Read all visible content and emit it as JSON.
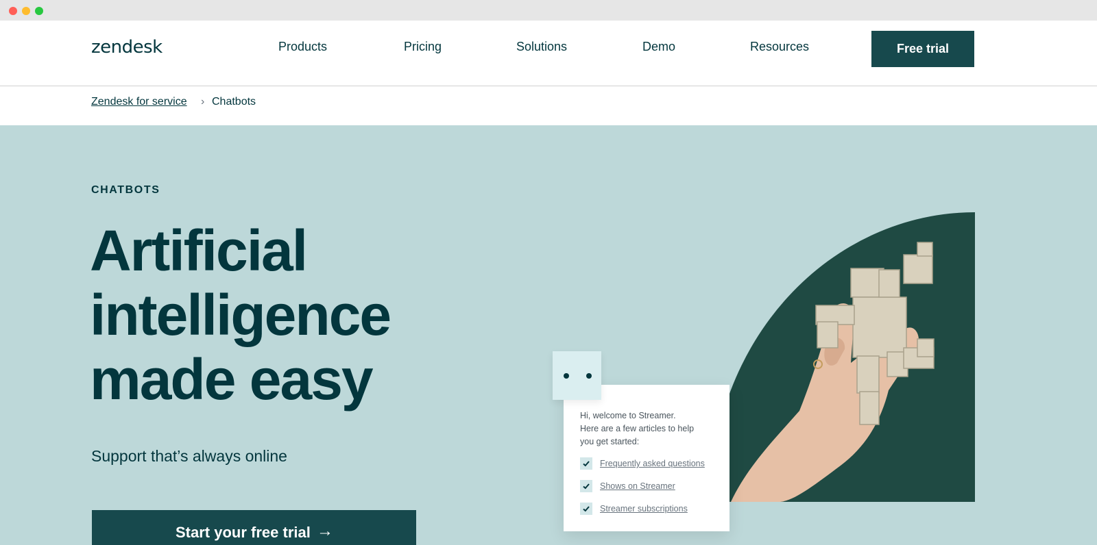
{
  "browser": {
    "window_controls": [
      "close",
      "minimize",
      "maximize"
    ]
  },
  "header": {
    "logo": "zendesk",
    "nav": [
      "Products",
      "Pricing",
      "Solutions",
      "Demo",
      "Resources"
    ],
    "cta_label": "Free trial"
  },
  "breadcrumb": {
    "parent": "Zendesk for service",
    "separator": "›",
    "current": "Chatbots"
  },
  "hero": {
    "eyebrow": "CHATBOTS",
    "headline": [
      "Artificial",
      "intelligence",
      "made easy"
    ],
    "subhead": "Support that’s always online",
    "cta_label": "Start your free trial",
    "cta_icon": "arrow-right-icon"
  },
  "chat_widget": {
    "greeting": [
      "Hi, welcome to Streamer.",
      "Here are a few articles to help",
      "you get started:"
    ],
    "links": [
      "Frequently asked questions",
      "Shows on Streamer",
      "Streamer subscriptions"
    ]
  },
  "colors": {
    "brand_dark": "#03363d",
    "button": "#17494d",
    "hero_background": "#bdd8d9",
    "photo_background": "#1f4a43"
  }
}
